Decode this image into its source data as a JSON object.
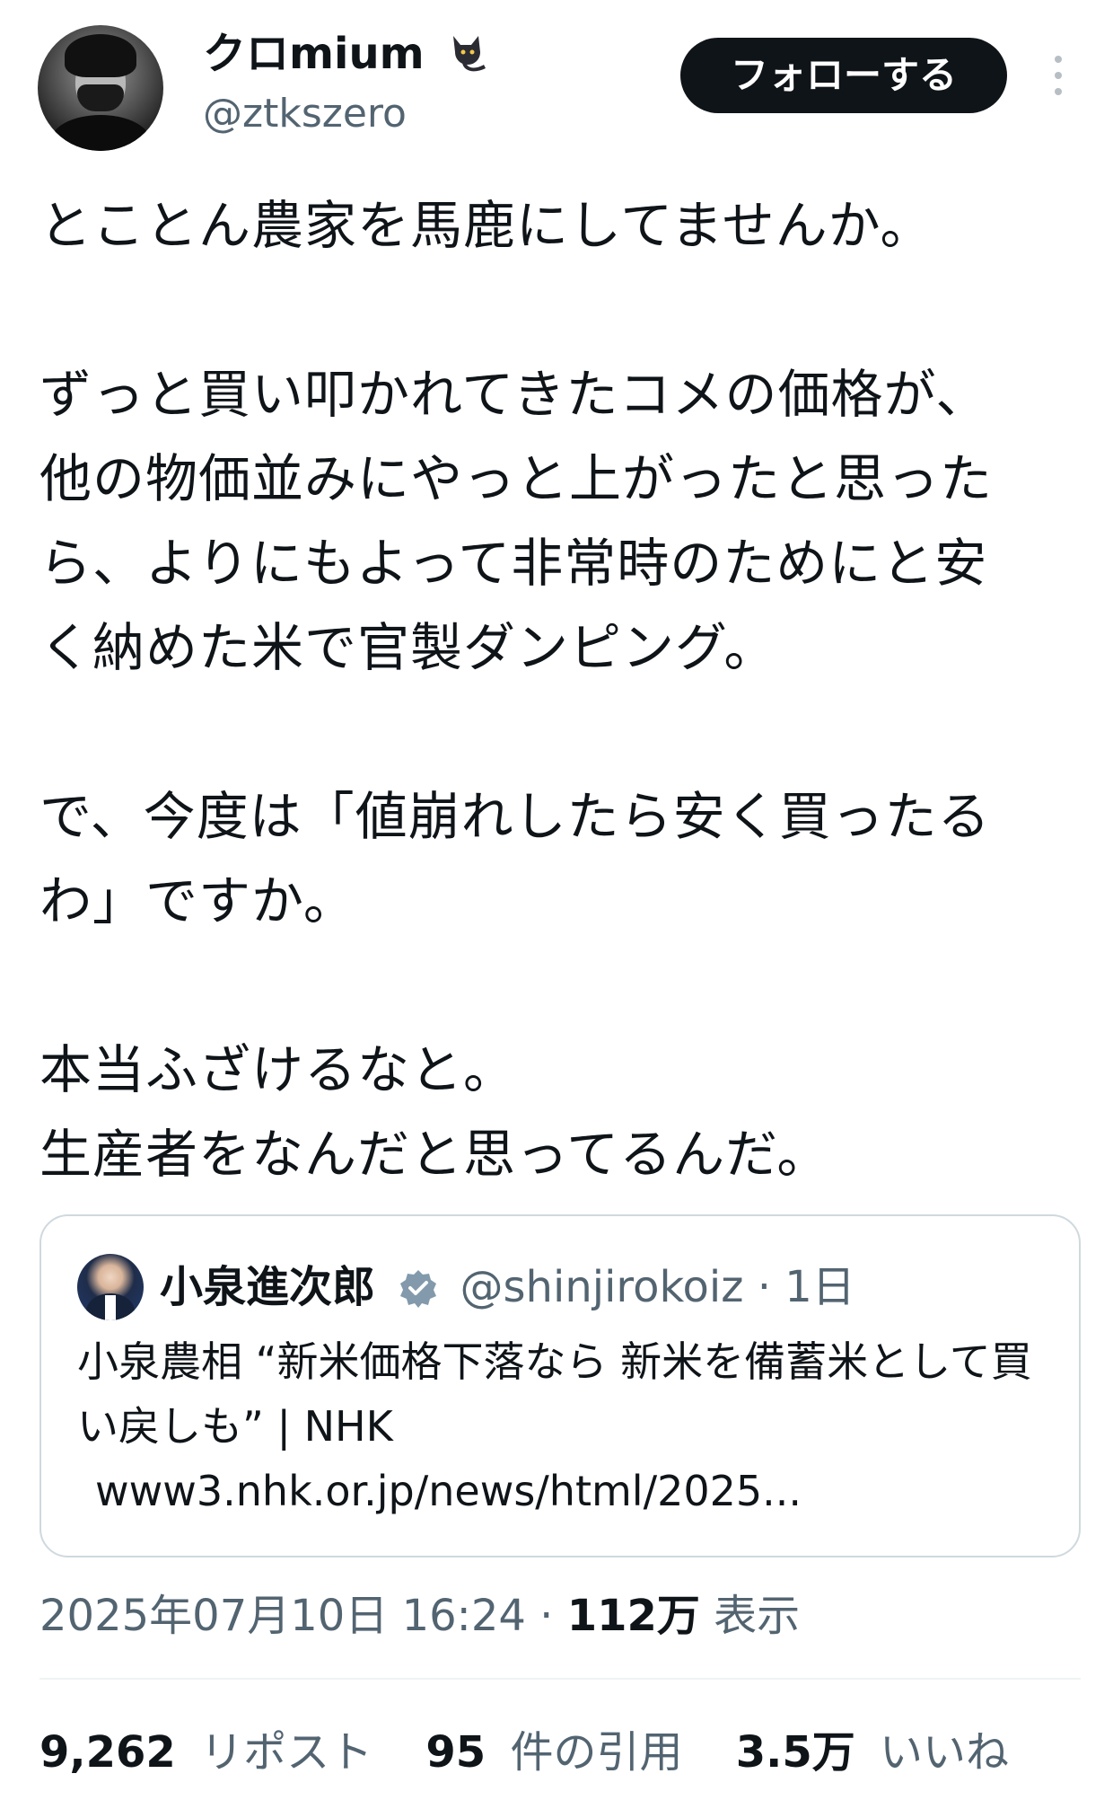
{
  "author": {
    "display_name": "クロmium",
    "emoji_icon": "black-cat-icon",
    "handle": "@ztkszero"
  },
  "actions": {
    "follow_label": "フォローする",
    "more_icon": "more-vertical-icon"
  },
  "tweet": {
    "text": "とことん農家を馬鹿にしてませんか。\n\nずっと買い叩かれてきたコメの価格が、\n他の物価並みにやっと上がったと思った\nら、よりにもよって非常時のためにと安\nく納めた米で官製ダンピング。\n\nで、今度は「値崩れしたら安く買ったる\nわ」ですか。\n\n本当ふざけるなと。\n生産者をなんだと思ってるんだ。"
  },
  "quote": {
    "display_name": "小泉進次郎",
    "verified_icon": "verified-badge-icon",
    "handle": "@shinjirokoiz",
    "separator": "·",
    "time": "1日",
    "text": "小泉農相 “新米価格下落なら 新米を備蓄米として買い戻しも” | NHK",
    "url": "www3.nhk.or.jp/news/html/2025..."
  },
  "meta": {
    "timestamp": "2025年07月10日 16:24",
    "separator": "·",
    "views_count": "112万",
    "views_label": "表示"
  },
  "stats": {
    "reposts_count": "9,262",
    "reposts_label": "リポスト",
    "quotes_count": "95",
    "quotes_label": "件の引用",
    "likes_count": "3.5万",
    "likes_label": "いいね"
  },
  "colors": {
    "text": "#0f1419",
    "secondary": "#536471",
    "border": "#cfd9de",
    "button": "#0f1419"
  }
}
